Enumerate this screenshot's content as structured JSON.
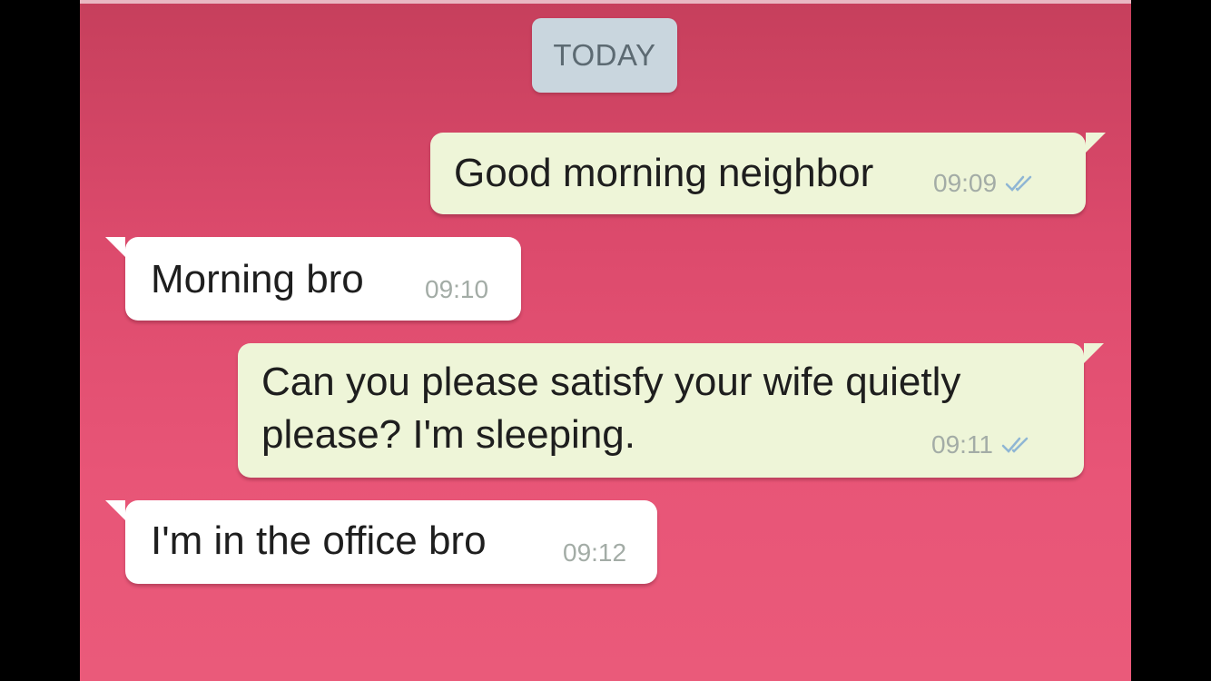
{
  "chat": {
    "date_label": "TODAY",
    "messages": [
      {
        "direction": "outgoing",
        "text": "Good morning neighbor",
        "time": "09:09",
        "status_icon": "double-check-icon"
      },
      {
        "direction": "incoming",
        "text": "Morning bro",
        "time": "09:10"
      },
      {
        "direction": "outgoing",
        "text": "Can you please satisfy your wife quietly please? I'm sleeping.",
        "time": "09:11",
        "status_icon": "double-check-icon"
      },
      {
        "direction": "incoming",
        "text": "I'm in the office bro",
        "time": "09:12"
      }
    ]
  },
  "colors": {
    "background": "#e0506f",
    "outgoing_bubble": "#eef5d8",
    "incoming_bubble": "#ffffff",
    "date_chip": "#c9d6de",
    "read_tick": "#8fb6d4"
  }
}
